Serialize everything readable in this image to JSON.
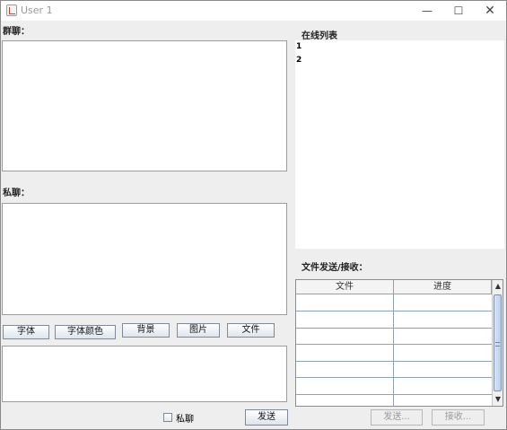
{
  "window": {
    "title": "User 1",
    "minimize_glyph": "—",
    "maximize_glyph": "☐",
    "close_glyph": "✕"
  },
  "group_chat": {
    "label": "群聊："
  },
  "private_chat": {
    "label": "私聊："
  },
  "toolbar": {
    "font_label": "字体",
    "font_color_label": "字体颜色",
    "background_label": "背景",
    "image_label": "图片",
    "file_label": "文件"
  },
  "online": {
    "label": "在线列表",
    "users": [
      "1",
      "2"
    ]
  },
  "file_transfer": {
    "label": "文件发送/接收：",
    "columns": [
      "文件",
      "进度"
    ],
    "send_label": "发送...",
    "receive_label": "接收..."
  },
  "compose": {
    "private_checkbox_label": "私聊",
    "private_checked": false,
    "send_label": "发送"
  },
  "icons": {
    "app_icon": "java-cup-icon",
    "scroll_up": "▲",
    "scroll_down": "▼"
  }
}
